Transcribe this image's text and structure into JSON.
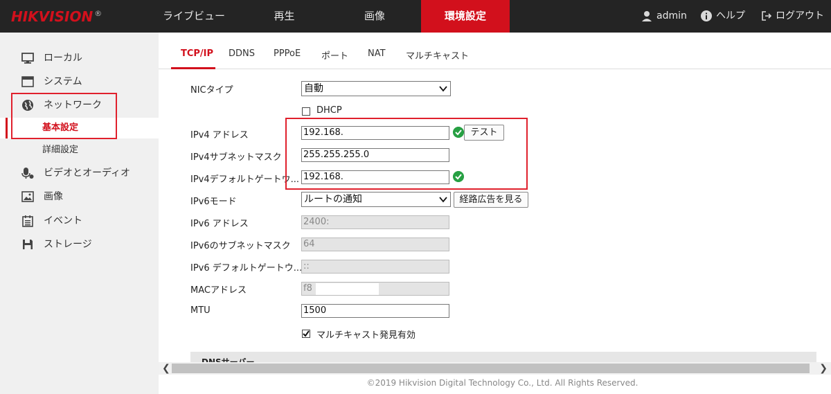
{
  "logo": {
    "text": "HIKVISION",
    "reg": "®"
  },
  "nav": {
    "live": "ライブビュー",
    "playback": "再生",
    "picture": "画像",
    "config": "環境設定"
  },
  "topright": {
    "user": "admin",
    "help": "ヘルプ",
    "logout": "ログアウト"
  },
  "sidebar": {
    "local": "ローカル",
    "system": "システム",
    "network": "ネットワーク",
    "basic": "基本設定",
    "advanced": "詳細設定",
    "video_audio": "ビデオとオーディオ",
    "image": "画像",
    "event": "イベント",
    "storage": "ストレージ"
  },
  "tabs": {
    "tcpip": "TCP/IP",
    "ddns": "DDNS",
    "pppoe": "PPPoE",
    "port": "ポート",
    "nat": "NAT",
    "multicast": "マルチキャスト"
  },
  "form": {
    "nic_label": "NICタイプ",
    "nic_value": "自動",
    "dhcp_label": "DHCP",
    "dhcp_checked": false,
    "ipv4_label": "IPv4 アドレス",
    "ipv4_value": "192.168.",
    "test_button": "テスト",
    "mask_label": "IPv4サブネットマスク",
    "mask_value": "255.255.255.0",
    "gw_label": "IPv4デフォルトゲートウ...",
    "gw_value": "192.168.",
    "ipv6mode_label": "IPv6モード",
    "ipv6mode_value": "ルートの通知",
    "route_button": "経路広告を見る",
    "ipv6_label": "IPv6 アドレス",
    "ipv6_value": "2400:",
    "ipv6mask_label": "IPv6のサブネットマスク",
    "ipv6mask_value": "64",
    "ipv6gw_label": "IPv6 デフォルトゲートウ...",
    "ipv6gw_value": "::",
    "mac_label": "MACアドレス",
    "mac_value": "f8",
    "mtu_label": "MTU",
    "mtu_value": "1500",
    "multicast_label": "マルチキャスト発見有効",
    "multicast_checked": true
  },
  "dns": {
    "title": "DNSサーバー"
  },
  "footer": "©2019 Hikvision Digital Technology Co., Ltd. All Rights Reserved.",
  "colors": {
    "accent": "#d2101c",
    "topbar": "#242424",
    "ok": "#27a043"
  }
}
